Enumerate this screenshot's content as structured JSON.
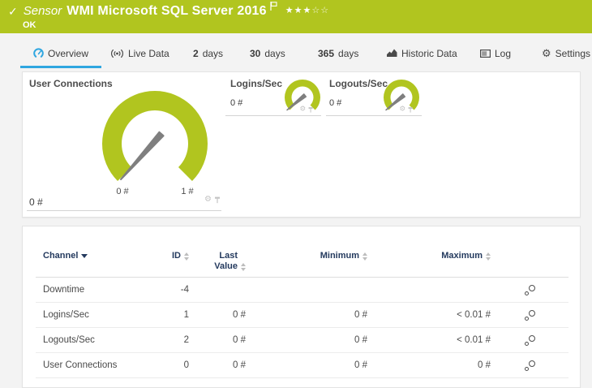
{
  "colors": {
    "brand_green": "#b1c51f",
    "accent_blue": "#2fa6e0",
    "table_header_text": "#243a5e",
    "needle_gray": "#7f7f7f"
  },
  "header": {
    "check_icon": "✓",
    "sensor_label": "Sensor",
    "title": "WMI Microsoft SQL Server 2016",
    "status": "OK",
    "priority_stars_filled": "★★★",
    "priority_stars_empty": "☆☆"
  },
  "tabs": {
    "overview": {
      "label": "Overview",
      "icon": "gauge-icon"
    },
    "live_data": {
      "label": "Live Data",
      "icon": "broadcast-icon"
    },
    "days2": {
      "num": "2",
      "unit": "days"
    },
    "days30": {
      "num": "30",
      "unit": "days"
    },
    "days365": {
      "num": "365",
      "unit": "days"
    },
    "historic": {
      "label": "Historic Data",
      "icon": "bar-chart-icon"
    },
    "log": {
      "label": "Log",
      "icon": "log-window-icon"
    },
    "settings": {
      "label": "Settings",
      "icon": "gear-icon"
    }
  },
  "gauges": {
    "user_connections": {
      "title": "User Connections",
      "value": "0 #",
      "scale_min": "0 #",
      "scale_max": "1 #"
    },
    "logins": {
      "title": "Logins/Sec",
      "value": "0 #"
    },
    "logouts": {
      "title": "Logouts/Sec",
      "value": "0 #"
    }
  },
  "table": {
    "headers": {
      "channel": "Channel",
      "id": "ID",
      "last_line1": "Last",
      "last_line2": "Value",
      "minimum": "Minimum",
      "maximum": "Maximum"
    },
    "rows": [
      {
        "channel": "Downtime",
        "id": "-4",
        "last": "",
        "min": "",
        "max": ""
      },
      {
        "channel": "Logins/Sec",
        "id": "1",
        "last": "0 #",
        "min": "0 #",
        "max": "< 0.01 #"
      },
      {
        "channel": "Logouts/Sec",
        "id": "2",
        "last": "0 #",
        "min": "0 #",
        "max": "< 0.01 #"
      },
      {
        "channel": "User Connections",
        "id": "0",
        "last": "0 #",
        "min": "0 #",
        "max": "0 #"
      }
    ]
  }
}
